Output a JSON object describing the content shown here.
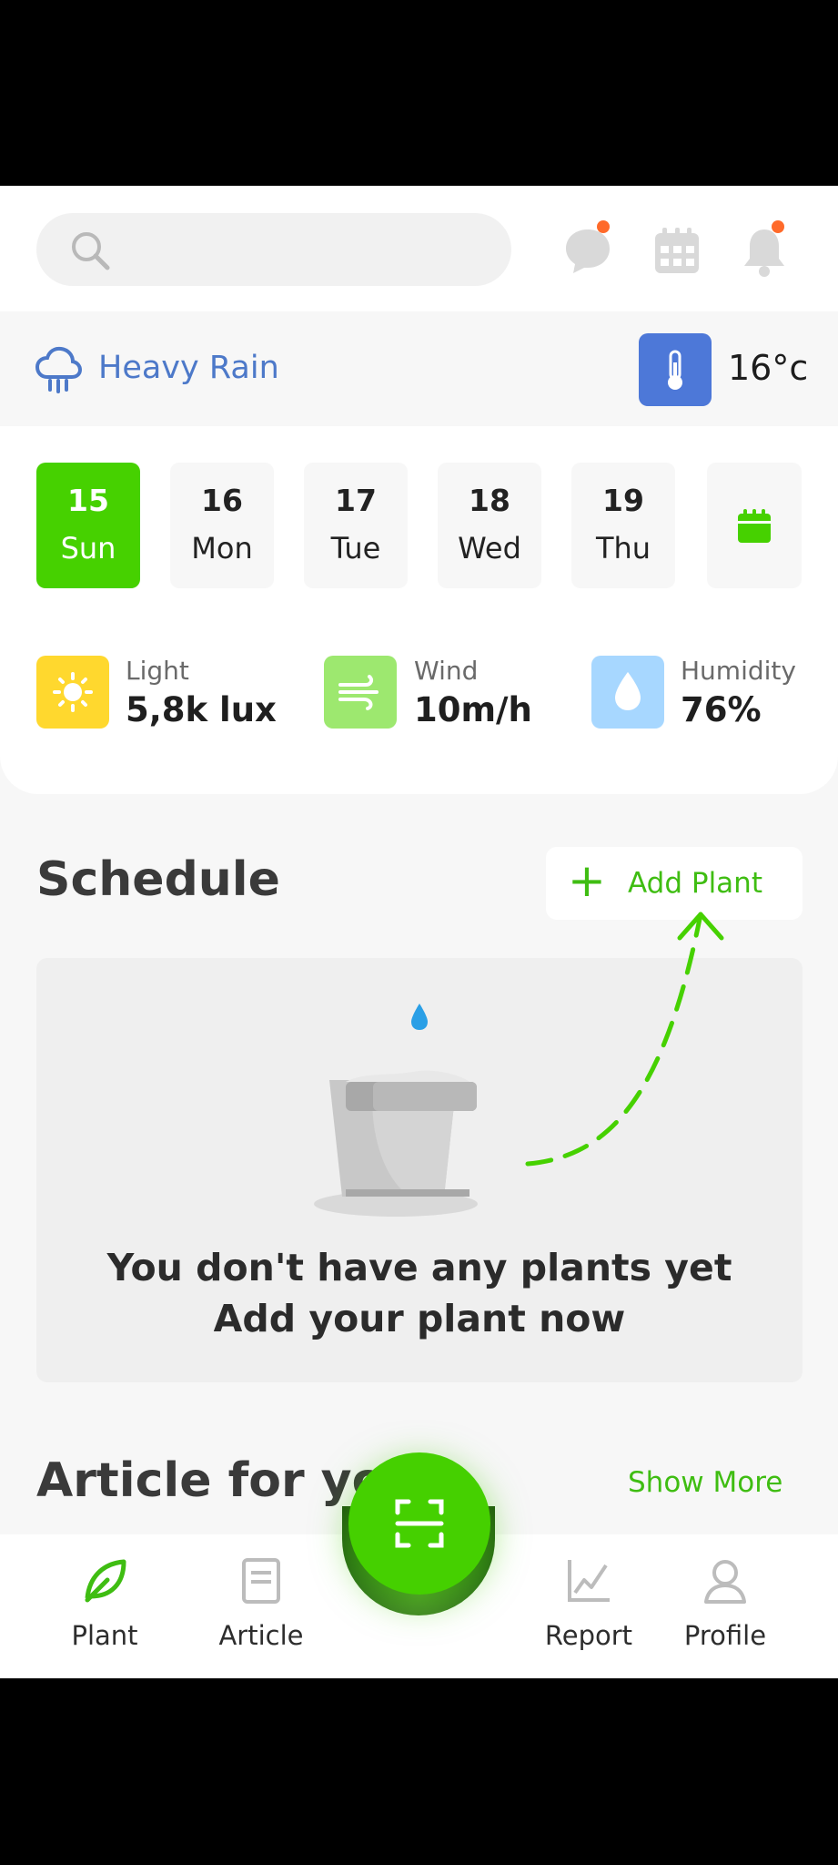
{
  "search": {
    "placeholder": ""
  },
  "weather": {
    "condition": "Heavy Rain",
    "temperature": "16°c"
  },
  "days": [
    {
      "num": "15",
      "name": "Sun",
      "active": true
    },
    {
      "num": "16",
      "name": "Mon",
      "active": false
    },
    {
      "num": "17",
      "name": "Tue",
      "active": false
    },
    {
      "num": "18",
      "name": "Wed",
      "active": false
    },
    {
      "num": "19",
      "name": "Thu",
      "active": false
    }
  ],
  "conditions": [
    {
      "label": "Light",
      "value": "5,8k lux",
      "color": "#ffd82e"
    },
    {
      "label": "Wind",
      "value": "10m/h",
      "color": "#9de86f"
    },
    {
      "label": "Humidity",
      "value": "76%",
      "color": "#a7d7ff"
    }
  ],
  "schedule": {
    "title": "Schedule",
    "add_label": "Add Plant",
    "empty_line1": "You don't have any plants yet",
    "empty_line2": "Add your plant now"
  },
  "articles": {
    "title": "Article for you",
    "show_more": "Show More"
  },
  "nav": {
    "plant": "Plant",
    "article": "Article",
    "report": "Report",
    "profile": "Profile"
  },
  "colors": {
    "accent": "#46d100",
    "weather": "#4d79c9",
    "notification": "#ff6a2a"
  }
}
